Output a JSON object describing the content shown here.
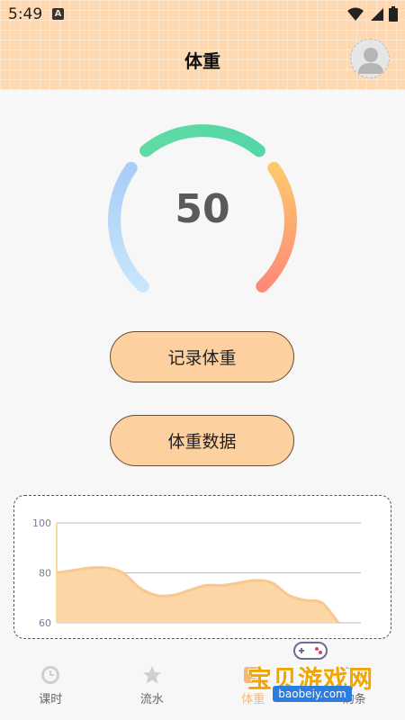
{
  "status_bar": {
    "time": "5:49",
    "notification_letter": "A",
    "icons": [
      "wifi-icon",
      "signal-icon",
      "battery-icon"
    ]
  },
  "header": {
    "title": "体重"
  },
  "gauge": {
    "value": "50",
    "colors": [
      "#a9d0f7",
      "#5ed9a8",
      "#fcc56a",
      "#fd8d78"
    ]
  },
  "buttons": {
    "record_label": "记录体重",
    "data_label": "体重数据"
  },
  "chart_data": {
    "type": "area",
    "y_ticks": [
      "100",
      "80",
      "60"
    ],
    "ylim": [
      60,
      100
    ],
    "grid": true,
    "fill_color": "#fdd6a8",
    "line_color": "#f8c88f",
    "series": [
      {
        "values": [
          80,
          81,
          82,
          82,
          80,
          74,
          71,
          71,
          73,
          75,
          75,
          76,
          77,
          76,
          71,
          69,
          68,
          60
        ]
      }
    ]
  },
  "tabbar": {
    "items": [
      {
        "label": "课时",
        "icon": "clock-icon"
      },
      {
        "label": "流水",
        "icon": "star-icon"
      },
      {
        "label": "体重",
        "icon": "scale-icon",
        "active": true
      },
      {
        "label": "购条",
        "icon": "cart-icon"
      }
    ],
    "active_color": "#f6b878"
  },
  "watermark": {
    "text": "宝贝游戏网",
    "url": "baobeiy.com"
  }
}
